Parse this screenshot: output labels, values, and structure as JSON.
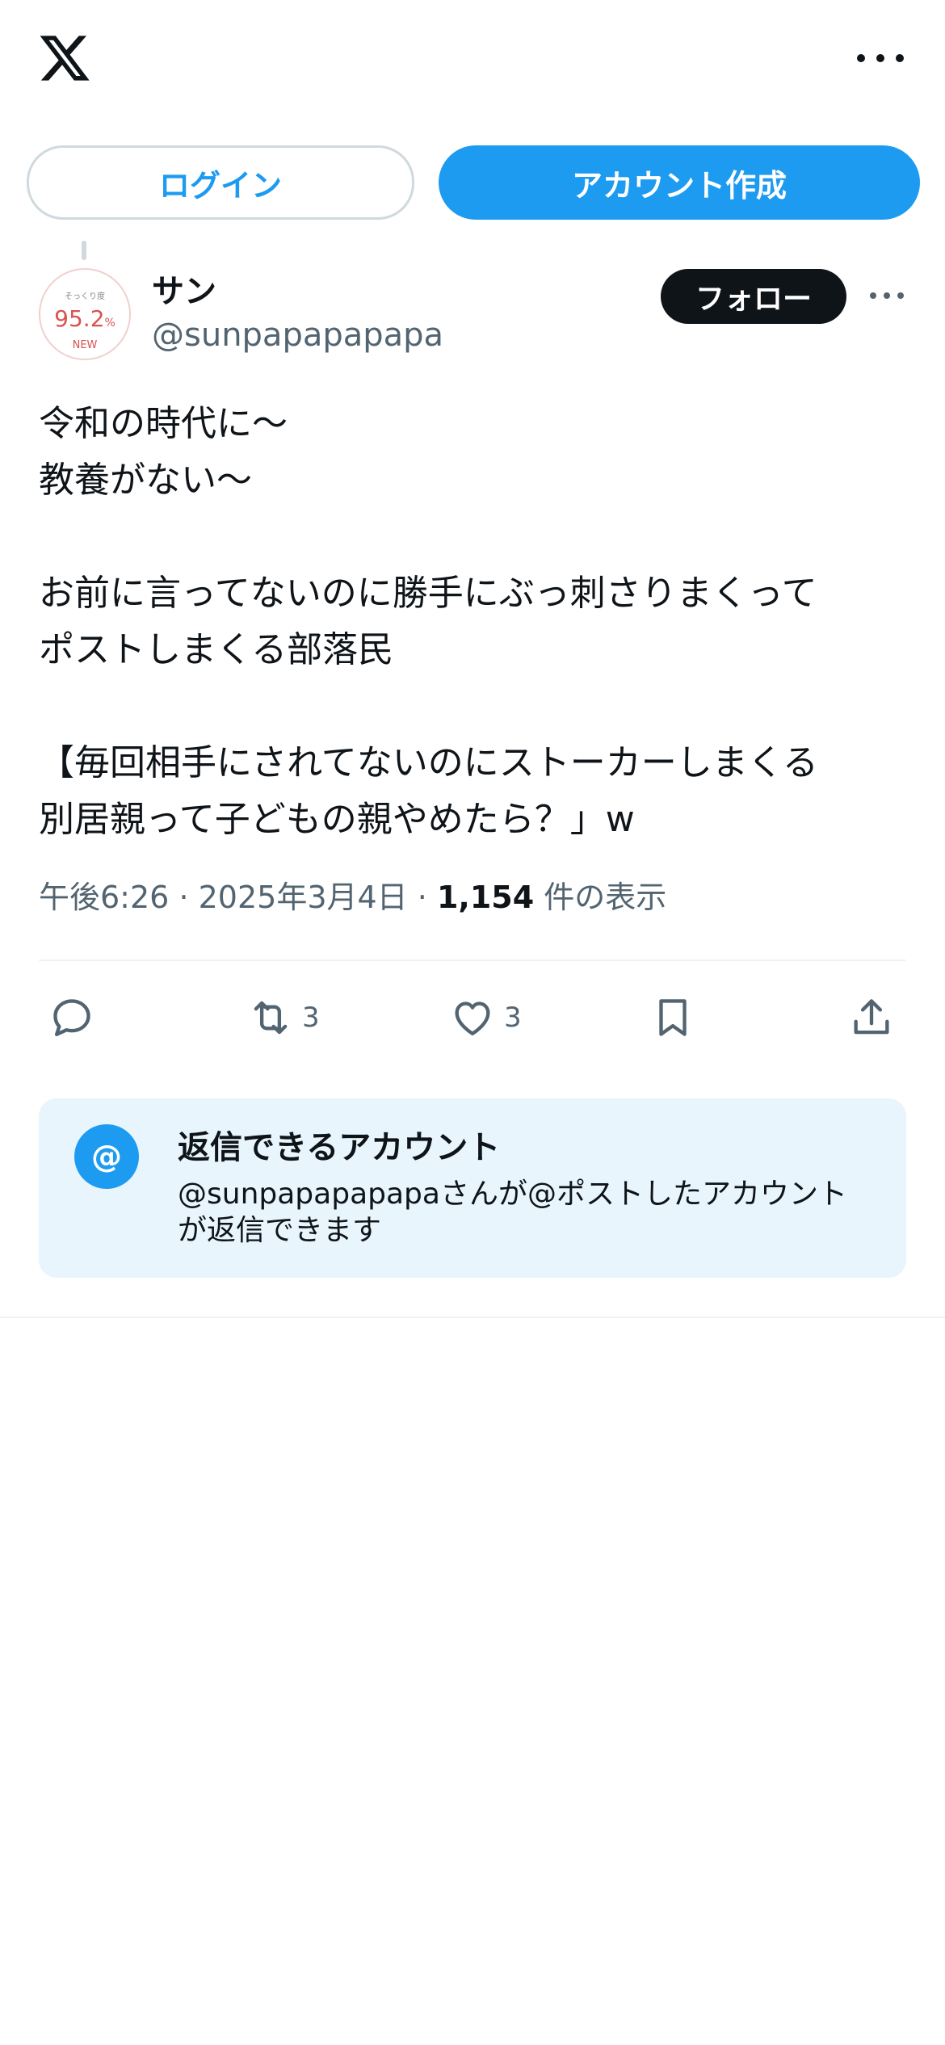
{
  "header": {
    "logo_icon": "x-logo-icon",
    "more_icon": "more-horizontal-icon"
  },
  "auth": {
    "login_label": "ログイン",
    "signup_label": "アカウント作成"
  },
  "post": {
    "avatar": {
      "line1": "そっくり度",
      "value": "95.2",
      "unit": "%",
      "badge": "NEW"
    },
    "display_name": "サン",
    "handle": "@sunpapapapapa",
    "follow_label": "フォロー",
    "text": "令和の時代に〜\n教養がない〜\n\nお前に言ってないのに勝手にぶっ刺さりまくって\nポストしまくる部落民\n\n【毎回相手にされてないのにストーカーしまくる\n別居親って子どもの親やめたら？」w",
    "meta": {
      "time": "午後6:26",
      "separator": "·",
      "date": "2025年3月4日",
      "views_count": "1,154",
      "views_label": "件の表示"
    },
    "actions": {
      "reply_icon": "reply-icon",
      "retweet_icon": "retweet-icon",
      "retweet_count": "3",
      "like_icon": "heart-icon",
      "like_count": "3",
      "bookmark_icon": "bookmark-icon",
      "share_icon": "share-icon"
    }
  },
  "reply_settings": {
    "icon": "@",
    "title": "返信できるアカウント",
    "description": "@sunpapapapapaさんが@ポストしたアカウントが返信できます"
  },
  "colors": {
    "accent": "#1d9bf0",
    "text_primary": "#0f1419",
    "text_secondary": "#536471",
    "reply_box_bg": "#e8f5fd"
  }
}
